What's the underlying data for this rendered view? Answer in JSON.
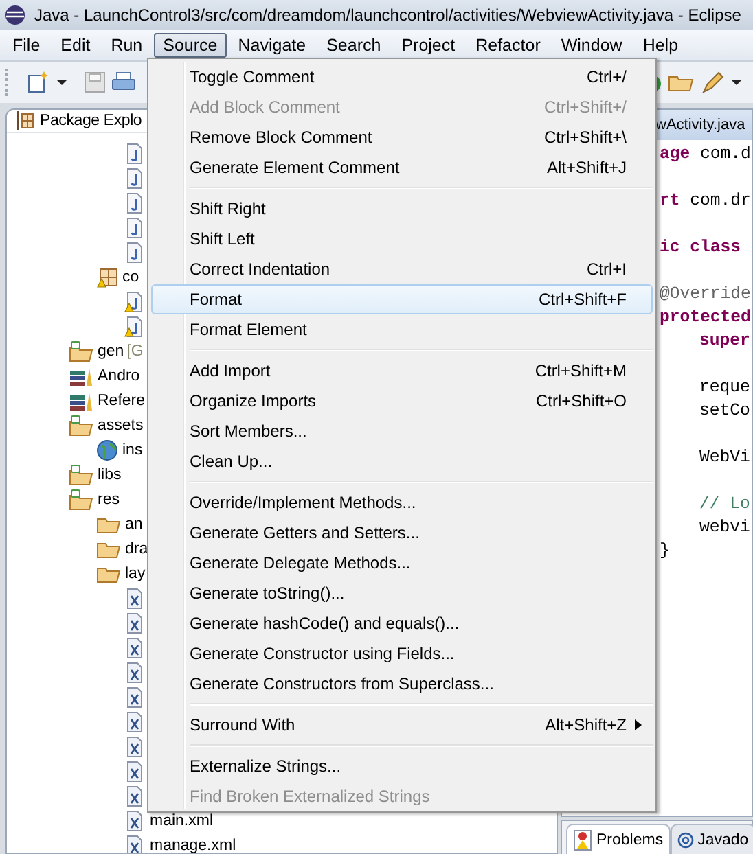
{
  "window": {
    "title": "Java - LaunchControl3/src/com/dreamdom/launchcontrol/activities/WebviewActivity.java - Eclipse"
  },
  "menu_bar": [
    {
      "label": "File",
      "selected": false
    },
    {
      "label": "Edit",
      "selected": false
    },
    {
      "label": "Run",
      "selected": false
    },
    {
      "label": "Source",
      "selected": true
    },
    {
      "label": "Navigate",
      "selected": false
    },
    {
      "label": "Search",
      "selected": false
    },
    {
      "label": "Project",
      "selected": false
    },
    {
      "label": "Refactor",
      "selected": false
    },
    {
      "label": "Window",
      "selected": false
    },
    {
      "label": "Help",
      "selected": false
    }
  ],
  "package_explorer": {
    "title": "Package Explo",
    "tree": [
      {
        "children": [
          {
            "children": [
              {
                "children": [
                  {
                    "kind": "java-file",
                    "warning": false
                  },
                  {
                    "kind": "java-file",
                    "warning": false
                  },
                  {
                    "kind": "java-file",
                    "warning": false
                  },
                  {
                    "kind": "java-file",
                    "warning": false
                  },
                  {
                    "kind": "java-file",
                    "warning": false
                  }
                ]
              },
              {
                "kind": "package",
                "label": "co",
                "warning": true,
                "children": [
                  {
                    "kind": "java-file",
                    "warning": true
                  },
                  {
                    "kind": "java-file",
                    "warning": true
                  }
                ]
              }
            ]
          },
          {
            "kind": "source-folder",
            "label": "gen",
            "decoration": "[G"
          },
          {
            "kind": "library",
            "label": "Andro"
          },
          {
            "kind": "library",
            "label": "Refere"
          },
          {
            "kind": "source-folder",
            "label": "assets",
            "children": [
              {
                "kind": "web-file",
                "label": "ins"
              }
            ]
          },
          {
            "kind": "source-folder",
            "label": "libs"
          },
          {
            "kind": "source-folder",
            "label": "res",
            "children": [
              {
                "kind": "folder",
                "label": "an"
              },
              {
                "kind": "folder",
                "label": "dra"
              },
              {
                "kind": "folder",
                "label": "lay",
                "children": [
                  {
                    "kind": "xml-file"
                  },
                  {
                    "kind": "xml-file"
                  },
                  {
                    "kind": "xml-file"
                  },
                  {
                    "kind": "xml-file"
                  },
                  {
                    "kind": "xml-file"
                  },
                  {
                    "kind": "xml-file"
                  },
                  {
                    "kind": "xml-file"
                  },
                  {
                    "kind": "xml-file"
                  },
                  {
                    "kind": "xml-file"
                  },
                  {
                    "kind": "xml-file",
                    "label": "main.xml"
                  },
                  {
                    "kind": "xml-file",
                    "label": "manage.xml"
                  }
                ]
              }
            ]
          }
        ]
      }
    ]
  },
  "editor": {
    "tab": "wActivity.java",
    "lines": [
      {
        "kind": "code",
        "indented": false,
        "tokens": [
          {
            "kind": "keyword",
            "text": "age"
          },
          {
            "kind": "plain",
            "text": " com.d"
          }
        ]
      },
      {
        "kind": "blank"
      },
      {
        "kind": "code",
        "indented": false,
        "tokens": [
          {
            "kind": "keyword",
            "text": "rt"
          },
          {
            "kind": "plain",
            "text": " com.dr"
          }
        ]
      },
      {
        "kind": "blank"
      },
      {
        "kind": "code",
        "indented": false,
        "tokens": [
          {
            "kind": "keyword",
            "text": "ic class"
          }
        ]
      },
      {
        "kind": "blank"
      },
      {
        "kind": "code",
        "indented": false,
        "tokens": [
          {
            "kind": "annotation",
            "text": "@Override"
          }
        ]
      },
      {
        "kind": "code",
        "indented": false,
        "tokens": [
          {
            "kind": "keyword",
            "text": "protected"
          }
        ]
      },
      {
        "kind": "code",
        "indented": true,
        "tokens": [
          {
            "kind": "keyword",
            "text": "super"
          }
        ]
      },
      {
        "kind": "blank"
      },
      {
        "kind": "code",
        "indented": true,
        "tokens": [
          {
            "kind": "plain",
            "text": "reque"
          }
        ]
      },
      {
        "kind": "code",
        "indented": true,
        "tokens": [
          {
            "kind": "plain",
            "text": "setCo"
          }
        ]
      },
      {
        "kind": "blank"
      },
      {
        "kind": "code",
        "indented": true,
        "tokens": [
          {
            "kind": "plain",
            "text": "WebVi"
          }
        ]
      },
      {
        "kind": "blank"
      },
      {
        "kind": "code",
        "indented": true,
        "tokens": [
          {
            "kind": "comment",
            "text": "// Lo"
          }
        ]
      },
      {
        "kind": "code",
        "indented": true,
        "tokens": [
          {
            "kind": "plain",
            "text": "webvi"
          }
        ]
      },
      {
        "kind": "code",
        "indented": false,
        "tokens": [
          {
            "kind": "plain",
            "text": "}"
          }
        ]
      }
    ]
  },
  "bottom_panel": {
    "tabs": [
      {
        "label": "Problems",
        "selected": true
      },
      {
        "label": "Javado",
        "selected": false
      }
    ]
  },
  "source_menu": {
    "items": [
      {
        "kind": "item",
        "label": "Toggle Comment",
        "shortcut": "Ctrl+/",
        "disabled": false,
        "selected": false
      },
      {
        "kind": "item",
        "label": "Add Block Comment",
        "shortcut": "Ctrl+Shift+/",
        "disabled": true,
        "selected": false
      },
      {
        "kind": "item",
        "label": "Remove Block Comment",
        "shortcut": "Ctrl+Shift+\\",
        "disabled": false,
        "selected": false
      },
      {
        "kind": "item",
        "label": "Generate Element Comment",
        "shortcut": "Alt+Shift+J",
        "disabled": false,
        "selected": false
      },
      {
        "kind": "separator"
      },
      {
        "kind": "item",
        "label": "Shift Right",
        "disabled": false,
        "selected": false
      },
      {
        "kind": "item",
        "label": "Shift Left",
        "disabled": false,
        "selected": false
      },
      {
        "kind": "item",
        "label": "Correct Indentation",
        "shortcut": "Ctrl+I",
        "disabled": false,
        "selected": false
      },
      {
        "kind": "item",
        "label": "Format",
        "shortcut": "Ctrl+Shift+F",
        "disabled": false,
        "selected": true
      },
      {
        "kind": "item",
        "label": "Format Element",
        "disabled": false,
        "selected": false
      },
      {
        "kind": "separator"
      },
      {
        "kind": "item",
        "label": "Add Import",
        "shortcut": "Ctrl+Shift+M",
        "disabled": false,
        "selected": false
      },
      {
        "kind": "item",
        "label": "Organize Imports",
        "shortcut": "Ctrl+Shift+O",
        "disabled": false,
        "selected": false
      },
      {
        "kind": "item",
        "label": "Sort Members...",
        "disabled": false,
        "selected": false
      },
      {
        "kind": "item",
        "label": "Clean Up...",
        "disabled": false,
        "selected": false
      },
      {
        "kind": "separator"
      },
      {
        "kind": "item",
        "label": "Override/Implement Methods...",
        "disabled": false,
        "selected": false
      },
      {
        "kind": "item",
        "label": "Generate Getters and Setters...",
        "disabled": false,
        "selected": false
      },
      {
        "kind": "item",
        "label": "Generate Delegate Methods...",
        "disabled": false,
        "selected": false
      },
      {
        "kind": "item",
        "label": "Generate toString()...",
        "disabled": false,
        "selected": false
      },
      {
        "kind": "item",
        "label": "Generate hashCode() and equals()...",
        "disabled": false,
        "selected": false
      },
      {
        "kind": "item",
        "label": "Generate Constructor using Fields...",
        "disabled": false,
        "selected": false
      },
      {
        "kind": "item",
        "label": "Generate Constructors from Superclass...",
        "disabled": false,
        "selected": false
      },
      {
        "kind": "separator"
      },
      {
        "kind": "item",
        "label": "Surround With",
        "shortcut": "Alt+Shift+Z",
        "submenu": true,
        "disabled": false,
        "selected": false
      },
      {
        "kind": "separator"
      },
      {
        "kind": "item",
        "label": "Externalize Strings...",
        "disabled": false,
        "selected": false
      },
      {
        "kind": "item",
        "label": "Find Broken Externalized Strings",
        "disabled": true,
        "selected": false
      }
    ]
  }
}
